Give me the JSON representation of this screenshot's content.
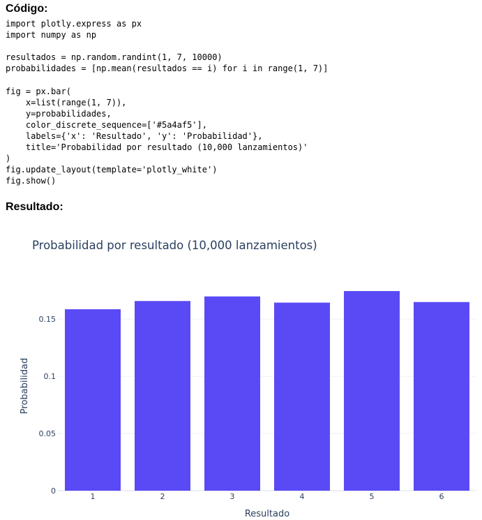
{
  "code_section": {
    "heading": "Código:",
    "code": "import plotly.express as px\nimport numpy as np\n\nresultados = np.random.randint(1, 7, 10000)\nprobabilidades = [np.mean(resultados == i) for i in range(1, 7)]\n\nfig = px.bar(\n    x=list(range(1, 7)),\n    y=probabilidades,\n    color_discrete_sequence=['#5a4af5'],\n    labels={'x': 'Resultado', 'y': 'Probabilidad'},\n    title='Probabilidad por resultado (10,000 lanzamientos)'\n)\nfig.update_layout(template='plotly_white')\nfig.show()"
  },
  "result_section": {
    "heading": "Resultado:"
  },
  "chart_data": {
    "type": "bar",
    "title": "Probabilidad por resultado (10,000 lanzamientos)",
    "xlabel": "Resultado",
    "ylabel": "Probabilidad",
    "categories": [
      "1",
      "2",
      "3",
      "4",
      "5",
      "6"
    ],
    "values": [
      0.1586,
      0.1658,
      0.1698,
      0.1644,
      0.1745,
      0.1649
    ],
    "ylim": [
      0,
      0.1745
    ],
    "yticks": [
      0,
      0.05,
      0.1,
      0.15
    ],
    "ytick_labels": [
      "0",
      "0.05",
      "0.1",
      "0.15"
    ],
    "bar_color": "#5a4af5",
    "grid_color": "#ebf0f8",
    "text_color": "#2a3f5f",
    "grid": true,
    "legend": false
  }
}
